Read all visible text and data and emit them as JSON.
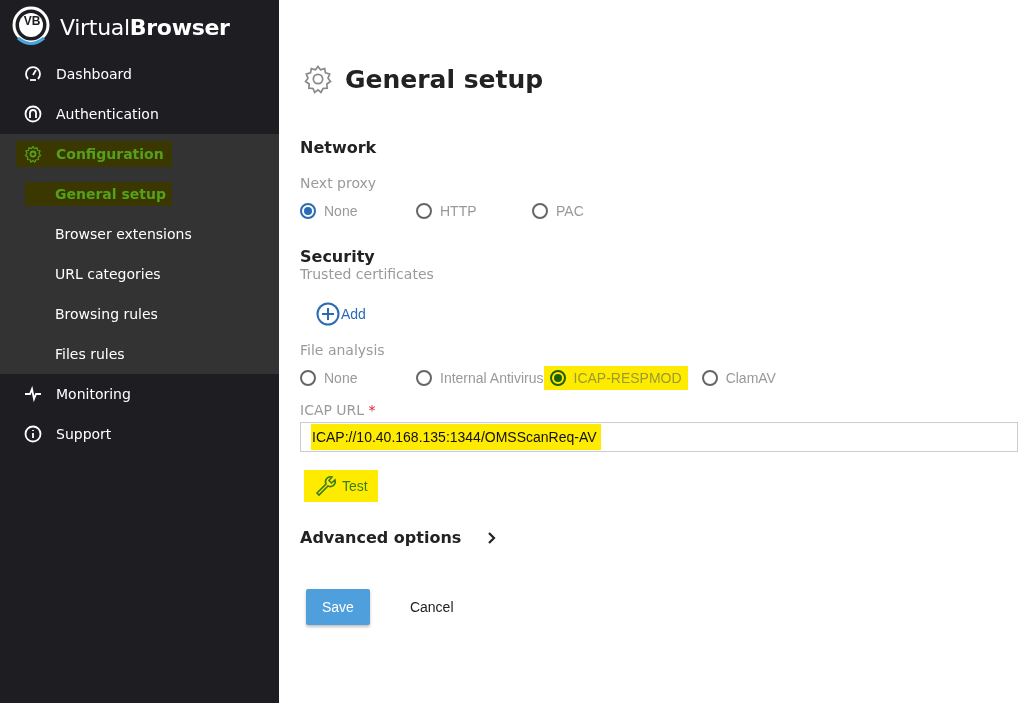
{
  "logo": {
    "badge": "VB",
    "name": "Virtual**Browser**"
  },
  "nav": [
    {
      "label": "Dashboard",
      "selected": false,
      "highlighted": false
    },
    {
      "label": "Authentication",
      "selected": false,
      "highlighted": false
    },
    {
      "label": "Configuration",
      "selected": true,
      "highlighted": true,
      "expanded": true,
      "children": [
        {
          "label": "General setup",
          "selected": true,
          "highlighted": true
        },
        {
          "label": "Browser extensions",
          "selected": false,
          "highlighted": false
        },
        {
          "label": "URL categories",
          "selected": false,
          "highlighted": false
        },
        {
          "label": "Browsing rules",
          "selected": false,
          "highlighted": false
        },
        {
          "label": "Files rules",
          "selected": false,
          "highlighted": false
        }
      ]
    },
    {
      "label": "Monitoring",
      "selected": false,
      "highlighted": false
    },
    {
      "label": "Support",
      "selected": false,
      "highlighted": false
    }
  ],
  "page": {
    "title": "General setup"
  },
  "network": {
    "heading": "Network",
    "next_proxy": {
      "label": "Next proxy",
      "options": [
        {
          "label": "None",
          "selected": true,
          "highlighted": false
        },
        {
          "label": "HTTP",
          "selected": false,
          "highlighted": false
        },
        {
          "label": "PAC",
          "selected": false,
          "highlighted": false
        }
      ]
    }
  },
  "security": {
    "heading": "Security",
    "trusted_certificates": {
      "label": "Trusted certificates",
      "add": "Add"
    },
    "file_analysis": {
      "label": "File analysis",
      "options": [
        {
          "label": "None",
          "selected": false,
          "highlighted": false
        },
        {
          "label": "Internal Antivirus",
          "selected": false,
          "highlighted": false
        },
        {
          "label": "ICAP-RESPMOD",
          "selected": true,
          "highlighted": true
        },
        {
          "label": "ClamAV",
          "selected": false,
          "highlighted": false
        }
      ]
    },
    "icap_url": {
      "label": "ICAP URL",
      "required": "*",
      "value": "ICAP://10.40.168.135:1344/OMSScanReq-AV",
      "highlighted": true
    },
    "test_button": {
      "label": "Test",
      "highlighted": true
    }
  },
  "advanced": {
    "label": "Advanced options",
    "expanded": false
  },
  "buttons": [
    {
      "kind": "primary",
      "label": "Save"
    },
    {
      "kind": "plain",
      "label": "Cancel"
    }
  ]
}
